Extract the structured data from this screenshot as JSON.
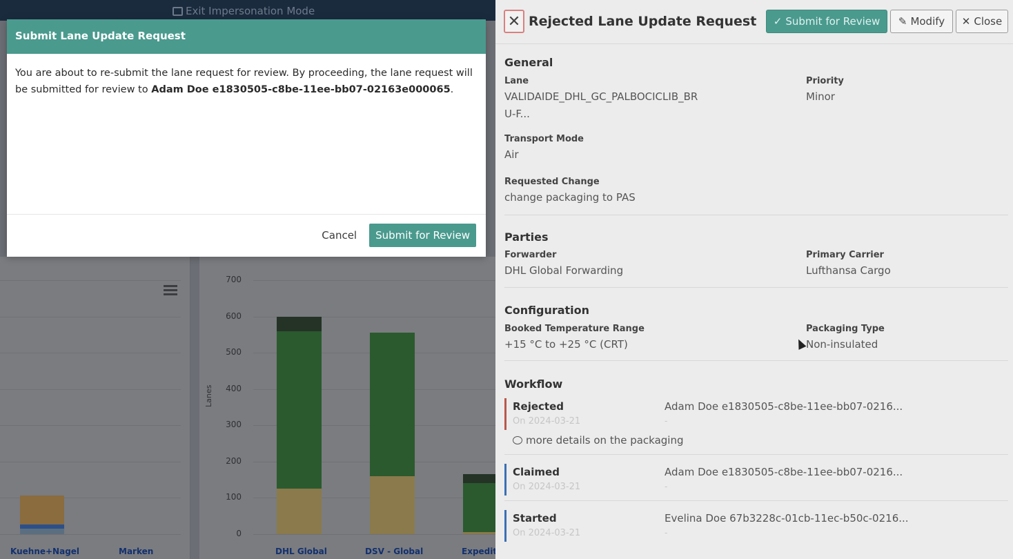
{
  "background": {
    "topbar": {
      "exit_impersonation": "Exit Impersonation Mode"
    },
    "chart": {
      "y_ticks": [
        "700",
        "600",
        "500",
        "400",
        "300",
        "200",
        "100",
        "0"
      ],
      "y_label": "Lanes",
      "categories_left": [
        "Kuehne+Nagel",
        "Marken"
      ],
      "categories_right": [
        "DHL Global",
        "DSV - Global",
        "Expedit"
      ]
    }
  },
  "chart_data": {
    "type": "bar",
    "ylabel": "Lanes",
    "ylim": [
      0,
      700
    ],
    "categories": [
      "DHL Global",
      "DSV - Global",
      "Expedit"
    ],
    "series": [
      {
        "values": [
          125,
          160,
          5
        ]
      },
      {
        "values": [
          435,
          395,
          135
        ]
      },
      {
        "values": [
          40,
          0,
          25
        ]
      }
    ],
    "colors": [
      "#bfa250",
      "#2b7c34",
      "#1f3f22"
    ]
  },
  "modal": {
    "title": "Submit Lane Update Request",
    "body_text": "You are about to re-submit the lane request for review. By proceeding, the lane request will be submitted for review to",
    "body_user": "Adam Doe e1830505-c8be-11ee-bb07-02163e000065",
    "body_end": ".",
    "cancel_label": "Cancel",
    "submit_label": "Submit for Review"
  },
  "panel": {
    "title": "Rejected Lane Update Request",
    "submit_label": "Submit for Review",
    "modify_label": "Modify",
    "close_label": "Close",
    "general": {
      "title": "General",
      "lane_label": "Lane",
      "lane_value_1": "VALIDAIDE_DHL_GC_PALBOCICLIB_BR",
      "lane_value_2": "U-F...",
      "priority_label": "Priority",
      "priority_value": "Minor",
      "transport_label": "Transport Mode",
      "transport_value": "Air",
      "change_label": "Requested Change",
      "change_value": "change packaging to PAS"
    },
    "parties": {
      "title": "Parties",
      "forwarder_label": "Forwarder",
      "forwarder_value": "DHL Global Forwarding",
      "carrier_label": "Primary Carrier",
      "carrier_value": "Lufthansa Cargo"
    },
    "configuration": {
      "title": "Configuration",
      "temp_label": "Booked Temperature Range",
      "temp_value": "+15 °C to +25 °C (CRT)",
      "pack_label": "Packaging Type",
      "pack_value": "Non-insulated"
    },
    "workflow": {
      "title": "Workflow",
      "items": [
        {
          "status": "Rejected",
          "date": "On 2024-03-21",
          "user": "Adam Doe e1830505-c8be-11ee-bb07-0216...",
          "dash": "-"
        },
        {
          "status": "Claimed",
          "date": "On 2024-03-21",
          "user": "Adam Doe e1830505-c8be-11ee-bb07-0216...",
          "dash": "-"
        },
        {
          "status": "Started",
          "date": "On 2024-03-21",
          "user": "Evelina Doe 67b3228c-01cb-11ec-b50c-0216...",
          "dash": "-"
        }
      ],
      "comment": "more details on the packaging",
      "colors": {
        "rejected": "#b9574a",
        "claimed": "#3b6fb5",
        "started": "#3b6fb5"
      }
    }
  }
}
